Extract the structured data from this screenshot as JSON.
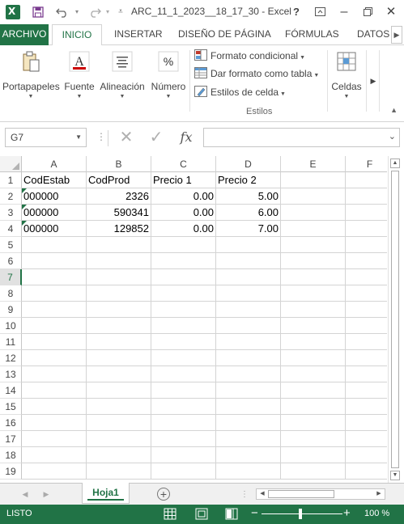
{
  "titlebar": {
    "title": "ARC_11_1_2023__18_17_30 - Excel",
    "help": "?",
    "app_letter": "X"
  },
  "tabs": {
    "file": "ARCHIVO",
    "home": "INICIO",
    "insert": "INSERTAR",
    "page_layout": "DISEÑO DE PÁGINA",
    "formulas": "FÓRMULAS",
    "data": "DATOS"
  },
  "ribbon": {
    "clipboard": "Portapapeles",
    "font": "Fuente",
    "alignment": "Alineación",
    "number": "Número",
    "conditional_format": "Formato condicional",
    "format_as_table": "Dar formato como tabla",
    "cell_styles": "Estilos de celda",
    "styles_group": "Estilos",
    "cells": "Celdas"
  },
  "formula_bar": {
    "name_box": "G7",
    "formula": ""
  },
  "grid": {
    "columns": [
      "A",
      "B",
      "C",
      "D",
      "E",
      "F"
    ],
    "rows": [
      "1",
      "2",
      "3",
      "4",
      "5",
      "6",
      "7",
      "8",
      "9",
      "10",
      "11",
      "12",
      "13",
      "14",
      "15",
      "16",
      "17",
      "18",
      "19"
    ],
    "active_row": "7",
    "cells": {
      "A1": "CodEstab",
      "B1": "CodProd",
      "C1": "Precio 1",
      "D1": "Precio 2",
      "A2": "000000",
      "B2": "2326",
      "C2": "0.00",
      "D2": "5.00",
      "A3": "000000",
      "B3": "590341",
      "C3": "0.00",
      "D3": "6.00",
      "A4": "000000",
      "B4": "129852",
      "C4": "0.00",
      "D4": "7.00"
    }
  },
  "sheets": {
    "active": "Hoja1"
  },
  "status": {
    "text": "LISTO",
    "zoom": "100 %"
  },
  "colors": {
    "accent": "#217346"
  }
}
